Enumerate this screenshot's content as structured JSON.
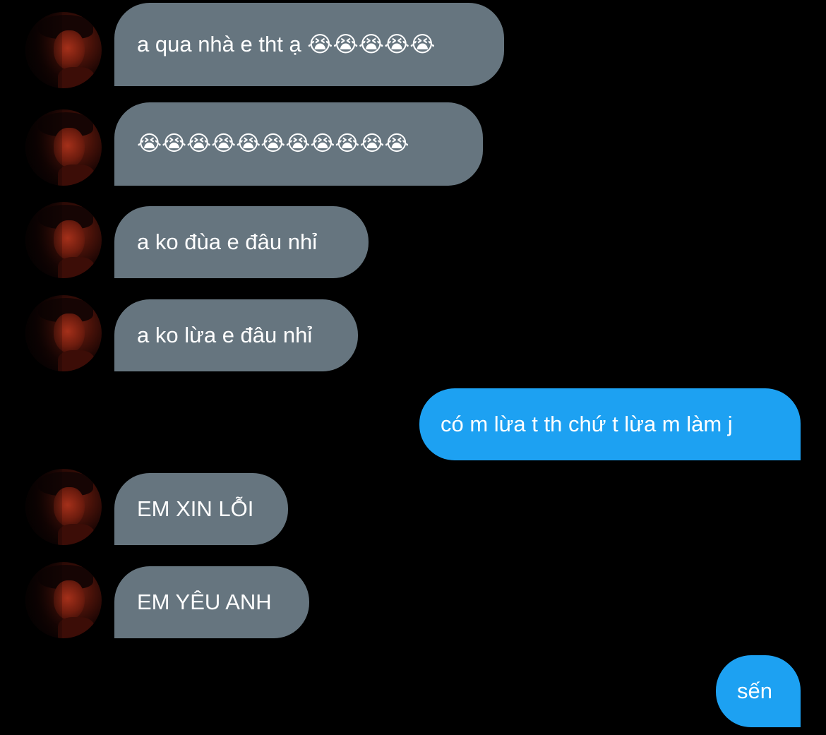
{
  "conversation": {
    "messages": [
      {
        "direction": "incoming",
        "text": "a qua nhà e tht ạ 😭😭😭😭😭"
      },
      {
        "direction": "incoming",
        "text": "😭😭😭😭😭😭😭😭😭😭😭"
      },
      {
        "direction": "incoming",
        "text": "a ko đùa e đâu nhỉ"
      },
      {
        "direction": "incoming",
        "text": "a ko lừa e đâu nhỉ"
      },
      {
        "direction": "outgoing",
        "text": "có m lừa t th chứ t lừa m làm j"
      },
      {
        "direction": "incoming",
        "text": "EM XIN LỖI"
      },
      {
        "direction": "incoming",
        "text": "EM YÊU ANH"
      },
      {
        "direction": "outgoing",
        "text": "sến"
      }
    ]
  },
  "colors": {
    "background": "#000000",
    "incoming_bubble": "#66757f",
    "outgoing_bubble": "#1da1f2",
    "text": "#ffffff"
  },
  "icons": {
    "crying_emoji": "loudly-crying-face"
  }
}
